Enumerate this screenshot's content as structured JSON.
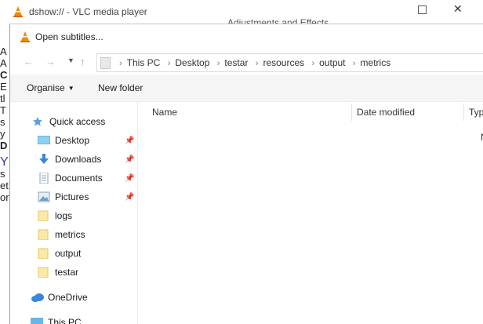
{
  "vlc": {
    "title": "dshow:// - VLC media player",
    "adjustments_title": "Adjustments and Effects",
    "left_fragments": [
      "A",
      "A",
      "C",
      "E",
      "tl",
      "T",
      "s",
      "y",
      "D",
      "Y",
      "s",
      "et",
      "or"
    ]
  },
  "dialog": {
    "title": "Open subtitles..."
  },
  "address": {
    "crumbs": [
      "This PC",
      "Desktop",
      "testar",
      "resources",
      "output",
      "metrics"
    ]
  },
  "toolbar": {
    "organise": "Organise",
    "new_folder": "New folder"
  },
  "nav": {
    "quick_access": "Quick access",
    "items": [
      {
        "label": "Desktop",
        "icon": "desktop-folder-icon",
        "pinned": true
      },
      {
        "label": "Downloads",
        "icon": "downloads-folder-icon",
        "pinned": true
      },
      {
        "label": "Documents",
        "icon": "documents-folder-icon",
        "pinned": true
      },
      {
        "label": "Pictures",
        "icon": "pictures-folder-icon",
        "pinned": true
      },
      {
        "label": "logs",
        "icon": "folder-icon",
        "pinned": false
      },
      {
        "label": "metrics",
        "icon": "folder-icon",
        "pinned": false
      },
      {
        "label": "output",
        "icon": "folder-icon",
        "pinned": false
      },
      {
        "label": "testar",
        "icon": "folder-icon",
        "pinned": false
      }
    ],
    "onedrive": "OneDrive",
    "this_pc": "This PC"
  },
  "columns": {
    "name": "Name",
    "date_modified": "Date modified",
    "type": "Typ"
  },
  "list_fragment": "N"
}
